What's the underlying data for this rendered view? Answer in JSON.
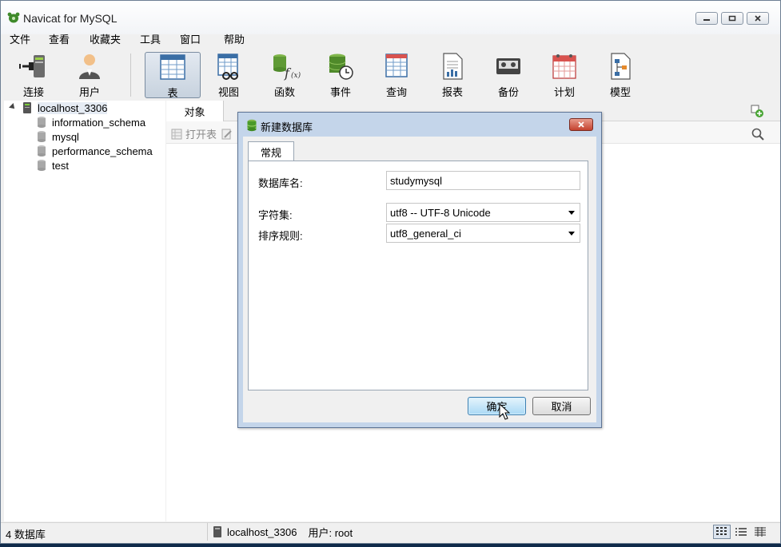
{
  "window": {
    "title": "Navicat for MySQL"
  },
  "menu": [
    "文件",
    "查看",
    "收藏夹",
    "工具",
    "窗口",
    "帮助"
  ],
  "toolbar": {
    "items": [
      {
        "label": "连接",
        "icon": "connection-plug-icon"
      },
      {
        "label": "用户",
        "icon": "user-icon"
      },
      {
        "label": "表",
        "icon": "table-icon",
        "active": true
      },
      {
        "label": "视图",
        "icon": "view-icon"
      },
      {
        "label": "函数",
        "icon": "function-icon"
      },
      {
        "label": "事件",
        "icon": "event-icon"
      },
      {
        "label": "查询",
        "icon": "query-icon"
      },
      {
        "label": "报表",
        "icon": "report-icon"
      },
      {
        "label": "备份",
        "icon": "backup-icon"
      },
      {
        "label": "计划",
        "icon": "schedule-icon"
      },
      {
        "label": "模型",
        "icon": "model-icon"
      }
    ]
  },
  "tree": {
    "connection": "localhost_3306",
    "databases": [
      "information_schema",
      "mysql",
      "performance_schema",
      "test"
    ]
  },
  "main": {
    "tab_label": "对象",
    "open_table_label": "打开表"
  },
  "dialog": {
    "title": "新建数据库",
    "tab": "常规",
    "fields": {
      "db_name_label": "数据库名:",
      "db_name_value": "studymysql",
      "charset_label": "字符集:",
      "charset_value": "utf8 -- UTF-8 Unicode",
      "collation_label": "排序规则:",
      "collation_value": "utf8_general_ci"
    },
    "ok_label": "确定",
    "cancel_label": "取消"
  },
  "status": {
    "db_count": "4 数据库",
    "connection": "localhost_3306",
    "user": "用户: root"
  },
  "colors": {
    "dialog_frame": "#c4d5ea",
    "primary_button": "#a9d9f5",
    "close_button": "#c4412e",
    "db_icon_green": "#4a9a2a"
  }
}
